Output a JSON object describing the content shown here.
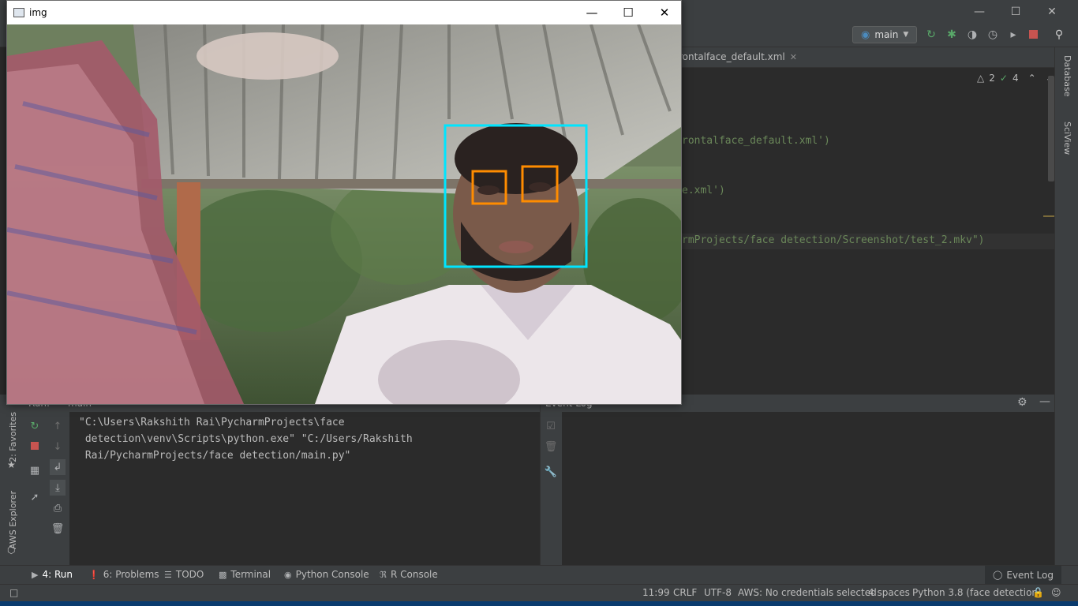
{
  "ide": {
    "run_config": "main",
    "editor": {
      "tab_label": "rontalface_default.xml",
      "inspections": {
        "warnings": "2",
        "ok": "4"
      },
      "lines": [
        {
          "text": "rontalface_default.xml')"
        },
        {
          "text": "e.xml')"
        },
        {
          "text": "rmProjects/face detection/Screenshot/test_2.mkv\")"
        }
      ]
    },
    "right_tools": [
      "Database",
      "SciView"
    ],
    "left_tools": [
      "2: Favorites",
      "AWS Explorer"
    ],
    "run_panel": {
      "title": "Run:",
      "tab": "main",
      "console_lines": [
        "\"C:\\Users\\Rakshith Rai\\PycharmProjects\\face",
        " detection\\venv\\Scripts\\python.exe\" \"C:/Users/Rakshith",
        " Rai/PycharmProjects/face detection/main.py\""
      ]
    },
    "event_log": {
      "title": "Event Log"
    },
    "tool_tabs": [
      {
        "label": "4: Run"
      },
      {
        "label": "6: Problems"
      },
      {
        "label": "TODO"
      },
      {
        "label": "Terminal"
      },
      {
        "label": "Python Console"
      },
      {
        "label": "R Console"
      }
    ],
    "event_log_tab": "Event Log",
    "status": {
      "position": "11:99",
      "line_sep": "CRLF",
      "encoding": "UTF-8",
      "aws": "AWS: No credentials selected",
      "indent": "4 spaces",
      "interpreter": "Python 3.8 (face detection)"
    }
  },
  "cv_window": {
    "title": "img",
    "detections": {
      "face_color": "#00e5ff",
      "eye_color": "#ff8c00"
    }
  },
  "colors": {
    "ide_bg": "#2b2b2b",
    "ide_panel": "#3c3f41",
    "string": "#6a8759",
    "run_green": "#59a869",
    "stop_red": "#c75450"
  }
}
